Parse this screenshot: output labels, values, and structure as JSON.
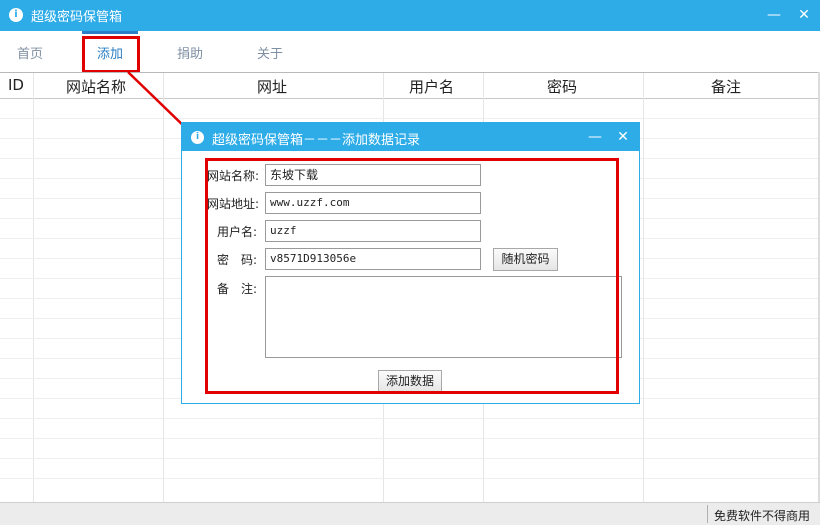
{
  "window": {
    "title": "超级密码保管箱",
    "minimize": "—",
    "close": "✕"
  },
  "nav": {
    "items": [
      "首页",
      "添加",
      "捐助",
      "关于"
    ],
    "active": "添加"
  },
  "table": {
    "columns": [
      "ID",
      "网站名称",
      "网址",
      "用户名",
      "密码",
      "备注"
    ],
    "rows": []
  },
  "status": {
    "text": "免费软件不得商用"
  },
  "dialog": {
    "title": "超级密码保管箱－－－添加数据记录",
    "minimize": "—",
    "close": "✕",
    "labels": {
      "site_name": "网站名称:",
      "site_url": "网站地址:",
      "username": "用户名:",
      "password": "密　码:",
      "note": "备　注:"
    },
    "values": {
      "site_name": "东坡下载",
      "site_url": "www.uzzf.com",
      "username": "uzzf",
      "password": "v8571D913056e",
      "note": ""
    },
    "random_password_button": "随机密码",
    "add_button": "添加数据"
  },
  "colors": {
    "titlebar": "#2dace8",
    "highlight": "#e00000",
    "nav_active": "#2b7fc4"
  }
}
